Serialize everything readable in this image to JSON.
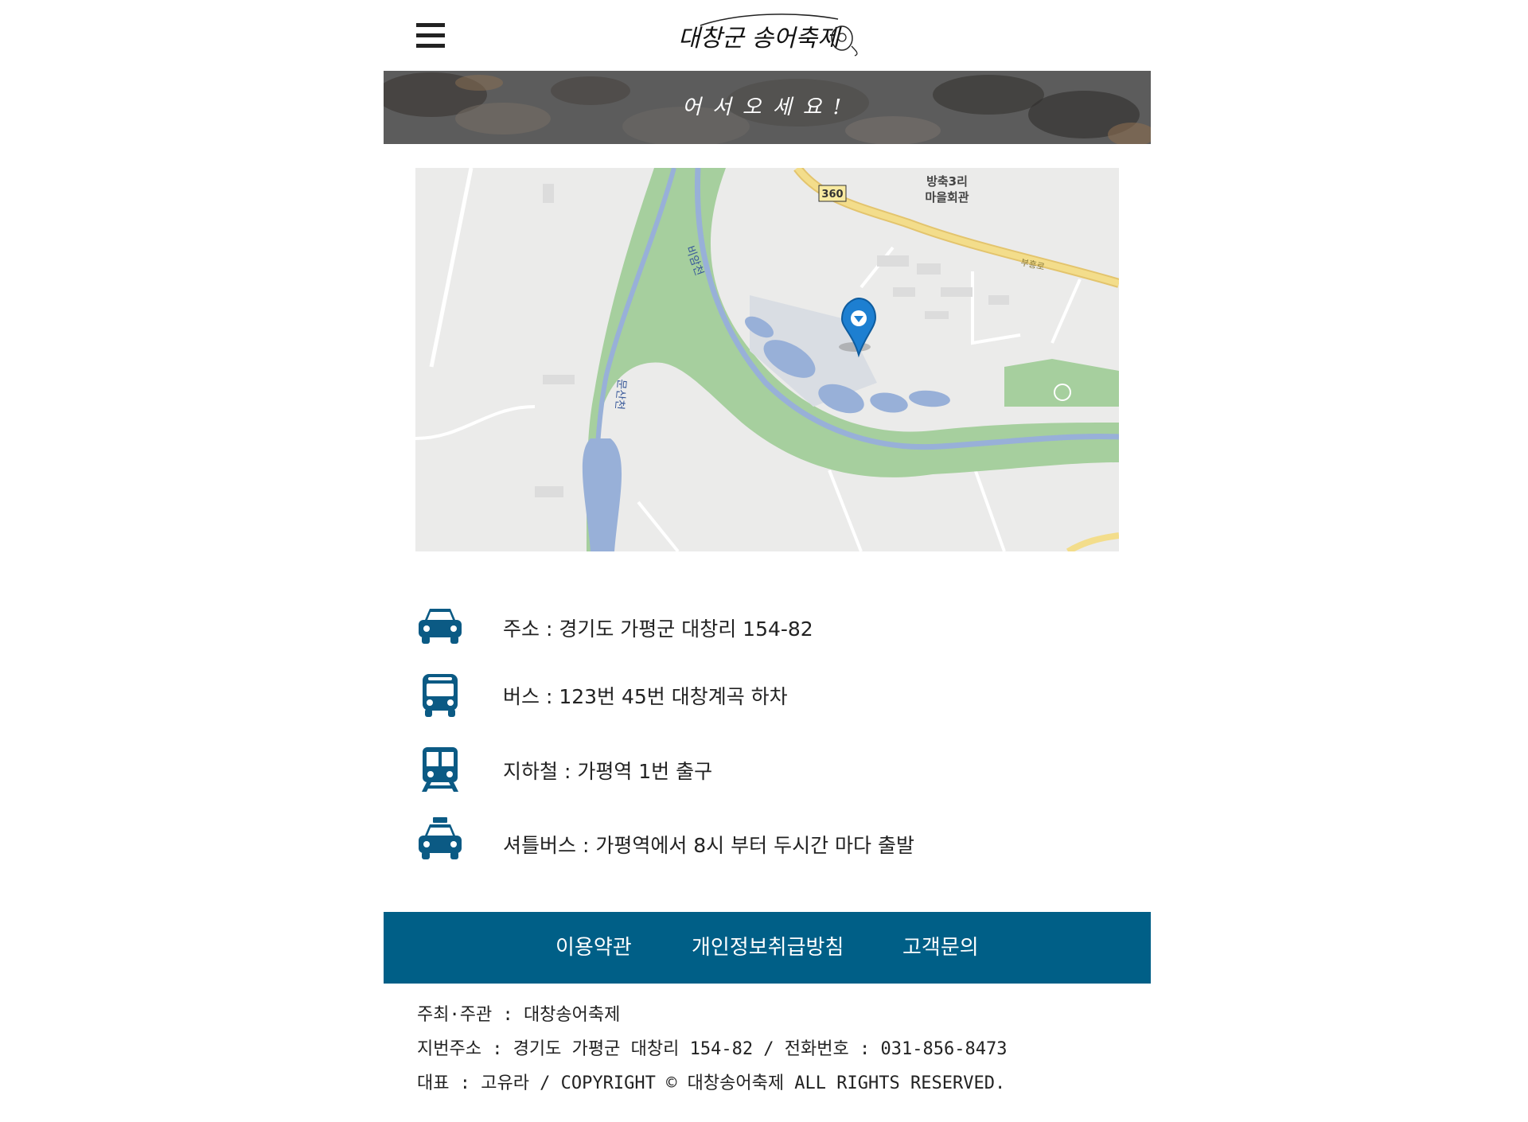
{
  "header": {
    "menu_icon": "hamburger-menu-icon",
    "logo_text": "대창군 송어축제"
  },
  "banner": {
    "text": "어서오세요!"
  },
  "map": {
    "labels": {
      "road_number": "360",
      "village_hall": [
        "방축3리",
        "마을회관"
      ],
      "stream_main": "비암천",
      "stream_side": "문산천",
      "road_name": "부흥로"
    }
  },
  "transit": [
    {
      "icon": "car-icon",
      "text": "주소 : 경기도 가평군 대창리 154-82"
    },
    {
      "icon": "bus-icon",
      "text": "버스 : 123번 45번 대창계곡 하차"
    },
    {
      "icon": "subway-icon",
      "text": "지하철 : 가평역 1번 출구"
    },
    {
      "icon": "taxi-icon",
      "text": "셔틀버스 : 가평역에서 8시 부터 두시간 마다 출발"
    }
  ],
  "footer": {
    "links": [
      "이용약관",
      "개인정보취급방침",
      "고객문의"
    ],
    "lines": [
      "주최·주관 : 대창송어축제",
      "지번주소 : 경기도 가평군 대창리 154-82  / 전화번호 : 031-856-8473",
      "대표 : 고유라 / COPYRIGHT © 대창송어축제 ALL RIGHTS RESERVED."
    ]
  },
  "colors": {
    "accent": "#005f87",
    "icon": "#0b5a84",
    "map_water": "#98b0d8",
    "map_park": "#a6cf9e",
    "map_road": "#f3dd8b"
  }
}
